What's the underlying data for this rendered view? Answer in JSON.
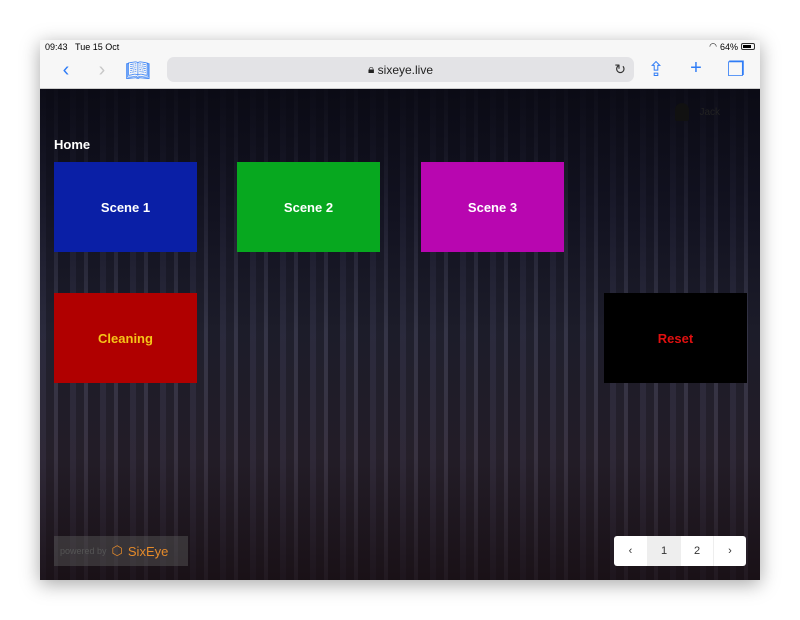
{
  "status": {
    "time": "09:43",
    "date": "Tue 15 Oct",
    "battery": "64%",
    "battery_level": 0.64
  },
  "browser": {
    "url": "sixeye.live",
    "back": "‹",
    "forward": "›"
  },
  "user": {
    "name": "Jack"
  },
  "breadcrumb": "Home",
  "tiles": [
    {
      "label": "Scene 1",
      "bg": "#0a1fa6",
      "color": "#ffffff"
    },
    {
      "label": "Scene 2",
      "bg": "#07a81f",
      "color": "#ffffff"
    },
    {
      "label": "Scene 3",
      "bg": "#b806b0",
      "color": "#ffffff"
    },
    {
      "label": "Cleaning",
      "bg": "#b00000",
      "color": "#f5c518"
    },
    {
      "label": "Reset",
      "bg": "#000000",
      "color": "#e01010"
    }
  ],
  "footer": {
    "powered_by": "powered by",
    "brand": "SixEye"
  },
  "pagination": {
    "prev": "‹",
    "pages": [
      "1",
      "2"
    ],
    "current": "1",
    "next": "›"
  }
}
